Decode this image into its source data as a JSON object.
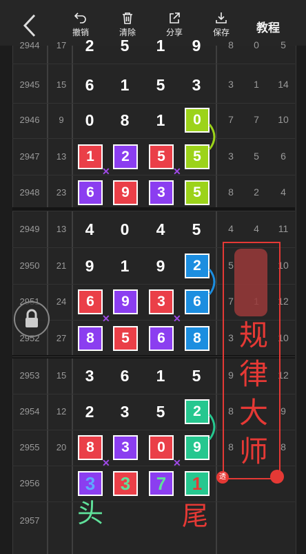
{
  "toolbar": {
    "undo_label": "撤销",
    "clear_label": "清除",
    "share_label": "分享",
    "save_label": "保存",
    "tutorial_label": "教程"
  },
  "rows": [
    {
      "id": "2944",
      "sum": "17",
      "digits": [
        "2",
        "5",
        "1",
        "9"
      ],
      "tails": [
        "8",
        "0",
        "5"
      ]
    },
    {
      "id": "2945",
      "sum": "15",
      "digits": [
        "6",
        "1",
        "5",
        "3"
      ],
      "tails": [
        "3",
        "1",
        "14"
      ]
    },
    {
      "id": "2946",
      "sum": "9",
      "digits": [
        "0",
        "8",
        "1",
        "0"
      ],
      "tails": [
        "7",
        "7",
        "10"
      ]
    },
    {
      "id": "2947",
      "sum": "13",
      "digits": [
        "1",
        "2",
        "5",
        "5"
      ],
      "tails": [
        "3",
        "5",
        "6"
      ]
    },
    {
      "id": "2948",
      "sum": "23",
      "digits": [
        "6",
        "9",
        "3",
        "5"
      ],
      "tails": [
        "8",
        "2",
        "4"
      ]
    },
    {
      "id": "2949",
      "sum": "13",
      "digits": [
        "4",
        "0",
        "4",
        "5"
      ],
      "tails": [
        "4",
        "4",
        "11"
      ]
    },
    {
      "id": "2950",
      "sum": "21",
      "digits": [
        "9",
        "1",
        "9",
        "2"
      ],
      "tails": [
        "5",
        "",
        "10"
      ]
    },
    {
      "id": "2951",
      "sum": "24",
      "digits": [
        "6",
        "9",
        "3",
        "6"
      ],
      "tails": [
        "7",
        "1",
        "12"
      ]
    },
    {
      "id": "2952",
      "sum": "27",
      "digits": [
        "8",
        "5",
        "6",
        "8"
      ],
      "tails": [
        "3",
        "",
        "10"
      ]
    },
    {
      "id": "2953",
      "sum": "15",
      "digits": [
        "3",
        "6",
        "1",
        "5"
      ],
      "tails": [
        "9",
        "",
        "12"
      ]
    },
    {
      "id": "2954",
      "sum": "12",
      "digits": [
        "2",
        "3",
        "5",
        "2"
      ],
      "tails": [
        "8",
        "",
        "9"
      ]
    },
    {
      "id": "2955",
      "sum": "20",
      "digits": [
        "8",
        "3",
        "0",
        "9"
      ],
      "tails": [
        "8",
        "",
        "8"
      ]
    },
    {
      "id": "2956",
      "sum": "",
      "digits": [
        "3",
        "3",
        "7",
        "1"
      ],
      "tails": [
        "",
        "",
        ""
      ]
    },
    {
      "id": "2957",
      "sum": "",
      "digits": [
        "",
        "",
        "",
        ""
      ],
      "tails": [
        "",
        "",
        ""
      ]
    }
  ],
  "annotations": {
    "side_text": "规律大师",
    "head_label": "头",
    "tail_label": "尾",
    "badge": "透"
  },
  "colors": {
    "red": "#ea3f48",
    "purple": "#8b3ef0",
    "lime": "#9cd31a",
    "blue": "#1c8ee0",
    "teal": "#26c78f",
    "annotation_red": "#e53935"
  },
  "icons": [
    "back-icon",
    "undo-icon",
    "trash-icon",
    "share-icon",
    "save-icon",
    "lock-icon"
  ]
}
